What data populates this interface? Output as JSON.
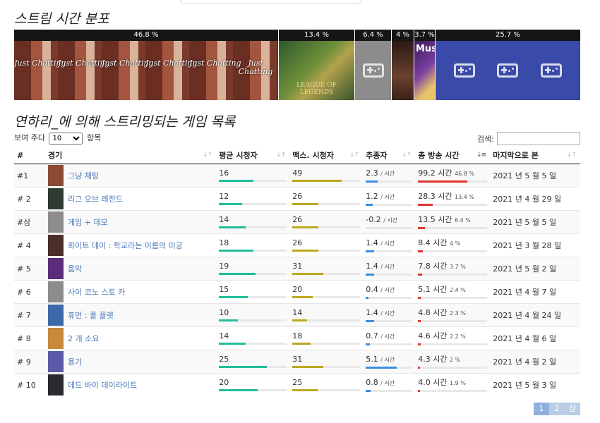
{
  "distribution_title": "스트림 시간 분포",
  "games_title": "연하리_에 의해 스트리밍되는 게임 목록",
  "distribution": [
    {
      "pct": "46.8 %",
      "game": "그냥 채팅",
      "art": "chat",
      "art_text": "Just Chatting"
    },
    {
      "pct": "13.4 %",
      "game": "리그 오브 레전드",
      "art": "lol",
      "art_text": "LEAGUE OF LEGENDS"
    },
    {
      "pct": "6.4 %",
      "game": "게임 + 데모",
      "art": "gray"
    },
    {
      "pct": "4 %",
      "game": "화이트 데이 : 학교라는 이름의 미궁",
      "art": "white"
    },
    {
      "pct": "3.7 %",
      "game": "음악",
      "art": "music",
      "art_text": "Music"
    },
    {
      "pct": "25.7 %",
      "game": "기타",
      "art": "blue"
    }
  ],
  "controls": {
    "length_prefix": "보여 주다",
    "length_value": "10",
    "length_options": [
      "10"
    ],
    "length_suffix": "항목",
    "search_label": "검색:",
    "search_value": ""
  },
  "columns": [
    "#",
    "경기",
    "평균 시청자",
    "맥스. 시청자",
    "추종자",
    "총 방송 시간",
    "마지막으로 본"
  ],
  "per_hour": "/ 시간",
  "hours_unit": "시간",
  "rows": [
    {
      "rank": "#1",
      "game": "그냥 채팅",
      "avg": "16",
      "avg_f": 0.72,
      "max": "49",
      "max_f": 1.0,
      "fol": "2.3",
      "fol_f": 0.35,
      "hours": "99.2",
      "share": "46.8 %",
      "hours_f": 1.0,
      "last": "2021 년 5 월 5 일",
      "thumb": "#8a4a34"
    },
    {
      "rank": "# 2",
      "game": "리그 오브 레전드",
      "avg": "12",
      "avg_f": 0.48,
      "max": "26",
      "max_f": 0.53,
      "fol": "1.2",
      "fol_f": 0.2,
      "hours": "28.3",
      "share": "13.4 %",
      "hours_f": 0.29,
      "last": "2021 년 4 월 29 일",
      "thumb": "#2f3b33"
    },
    {
      "rank": "#삼",
      "game": "게임 + 데모",
      "avg": "14",
      "avg_f": 0.56,
      "max": "26",
      "max_f": 0.53,
      "fol": "-0.2",
      "fol_f": 0.0,
      "hours": "13.5",
      "share": "6.4 %",
      "hours_f": 0.14,
      "last": "2021 년 5 월 5 일",
      "thumb": "#8c8c8c"
    },
    {
      "rank": "# 4",
      "game": "화이트 데이 : 학교라는 이름의 미궁",
      "avg": "18",
      "avg_f": 0.72,
      "max": "26",
      "max_f": 0.53,
      "fol": "1.4",
      "fol_f": 0.24,
      "hours": "8.4",
      "share": "4 %",
      "hours_f": 0.09,
      "last": "2021 년 3 월 28 일",
      "thumb": "#4a2e28"
    },
    {
      "rank": "# 5",
      "game": "음악",
      "avg": "19",
      "avg_f": 0.76,
      "max": "31",
      "max_f": 0.63,
      "fol": "1.4",
      "fol_f": 0.24,
      "hours": "7.8",
      "share": "3.7 %",
      "hours_f": 0.08,
      "last": "2021 년 5 월 2 일",
      "thumb": "#5a2c7a"
    },
    {
      "rank": "# 6",
      "game": "사이 코노 스토 카",
      "avg": "15",
      "avg_f": 0.6,
      "max": "20",
      "max_f": 0.41,
      "fol": "0.4",
      "fol_f": 0.07,
      "hours": "5.1",
      "share": "2.4 %",
      "hours_f": 0.05,
      "last": "2021 년 4 월 7 일",
      "thumb": "#8c8c8c"
    },
    {
      "rank": "# 7",
      "game": "휴먼 : 폴 플랫",
      "avg": "10",
      "avg_f": 0.4,
      "max": "14",
      "max_f": 0.29,
      "fol": "1.4",
      "fol_f": 0.24,
      "hours": "4.8",
      "share": "2.3 %",
      "hours_f": 0.05,
      "last": "2021 년 4 월 24 일",
      "thumb": "#3c6aa8"
    },
    {
      "rank": "# 8",
      "game": "2 개 소요",
      "avg": "14",
      "avg_f": 0.56,
      "max": "18",
      "max_f": 0.37,
      "fol": "0.7",
      "fol_f": 0.12,
      "hours": "4.6",
      "share": "2.2 %",
      "hours_f": 0.05,
      "last": "2021 년 4 월 6 일",
      "thumb": "#c8893a"
    },
    {
      "rank": "# 9",
      "game": "용기",
      "avg": "25",
      "avg_f": 1.0,
      "max": "31",
      "max_f": 0.63,
      "fol": "5.1",
      "fol_f": 0.92,
      "hours": "4.3",
      "share": "2 %",
      "hours_f": 0.04,
      "last": "2021 년 4 월 2 일",
      "thumb": "#5a5aa8"
    },
    {
      "rank": "# 10",
      "game": "데드 바이 데이라이트",
      "avg": "20",
      "avg_f": 0.8,
      "max": "25",
      "max_f": 0.51,
      "fol": "0.8",
      "fol_f": 0.14,
      "hours": "4.0",
      "share": "1.9 %",
      "hours_f": 0.04,
      "last": "2021 년 5 월 3 일",
      "thumb": "#2a2a30"
    }
  ],
  "pagination": [
    "1",
    "2",
    "삼"
  ],
  "pagination_current": 0
}
